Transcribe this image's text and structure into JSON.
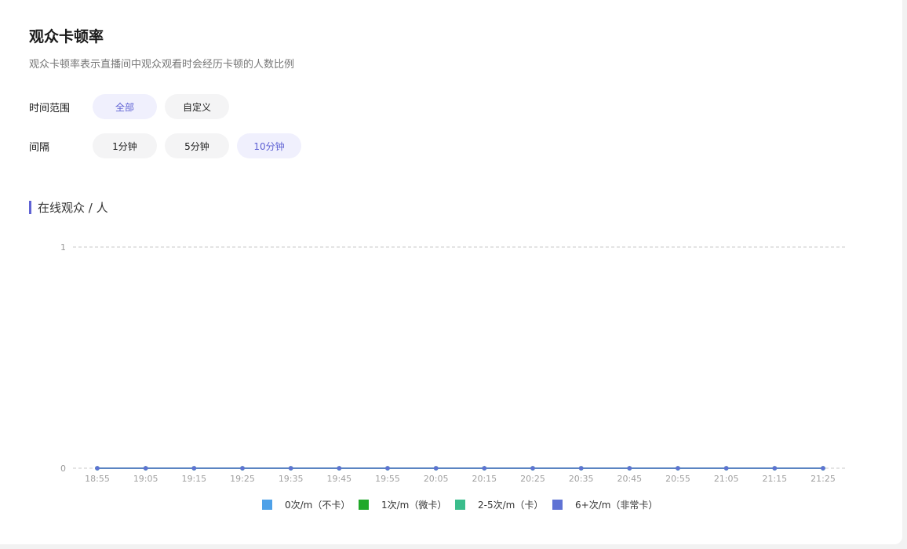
{
  "header": {
    "title": "观众卡顿率",
    "description": "观众卡顿率表示直播间中观众观看时会经历卡顿的人数比例"
  },
  "filters": {
    "time_range": {
      "label": "时间范围",
      "options": [
        "全部",
        "自定义"
      ],
      "selected": "全部"
    },
    "interval": {
      "label": "间隔",
      "options": [
        "1分钟",
        "5分钟",
        "10分钟"
      ],
      "selected": "10分钟"
    }
  },
  "accent_color": "#6063d4",
  "chart_section": {
    "title": "在线观众 / 人"
  },
  "chart_data": {
    "type": "line",
    "categories": [
      "18:55",
      "19:05",
      "19:15",
      "19:25",
      "19:35",
      "19:45",
      "19:55",
      "20:05",
      "20:15",
      "20:25",
      "20:35",
      "20:45",
      "20:55",
      "21:05",
      "21:15",
      "21:25"
    ],
    "ylim": [
      0,
      1
    ],
    "yticks": [
      "0",
      "1"
    ],
    "grid": true,
    "legend_position": "bottom",
    "series": [
      {
        "name": "0次/m（不卡）",
        "color": "#4ea1e8",
        "values": [
          0,
          0,
          0,
          0,
          0,
          0,
          0,
          0,
          0,
          0,
          0,
          0,
          0,
          0,
          0,
          0
        ]
      },
      {
        "name": "1次/m（微卡）",
        "color": "#21a829",
        "values": [
          0,
          0,
          0,
          0,
          0,
          0,
          0,
          0,
          0,
          0,
          0,
          0,
          0,
          0,
          0,
          0
        ]
      },
      {
        "name": "2-5次/m（卡）",
        "color": "#3bbd8c",
        "values": [
          0,
          0,
          0,
          0,
          0,
          0,
          0,
          0,
          0,
          0,
          0,
          0,
          0,
          0,
          0,
          0
        ]
      },
      {
        "name": "6+次/m（非常卡）",
        "color": "#5f72d4",
        "values": [
          0,
          0,
          0,
          0,
          0,
          0,
          0,
          0,
          0,
          0,
          0,
          0,
          0,
          0,
          0,
          0
        ]
      }
    ]
  }
}
